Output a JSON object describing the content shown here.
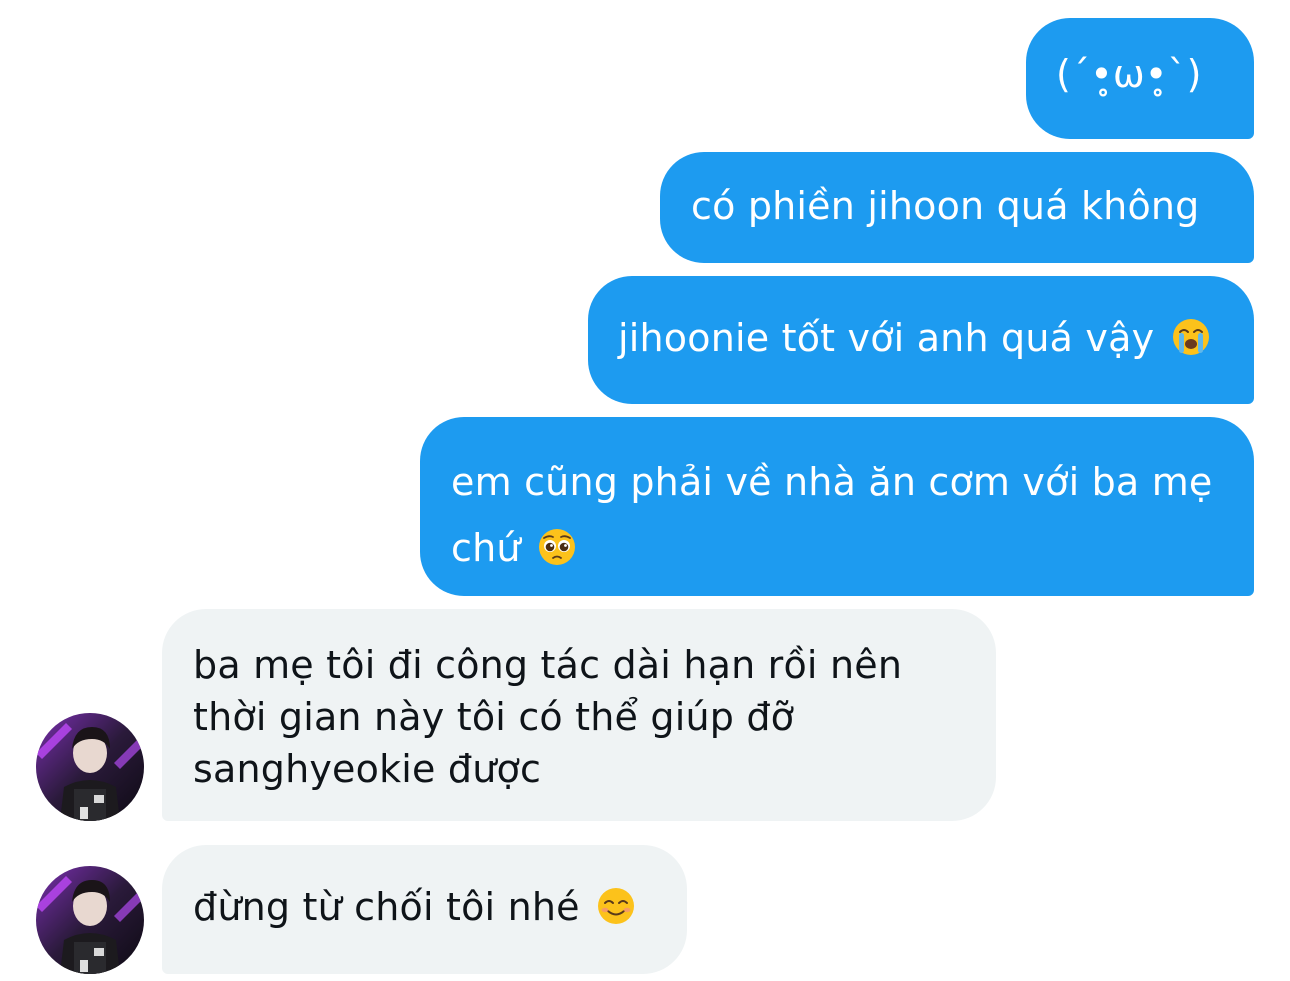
{
  "messages": {
    "m1": {
      "text": "(´•̥ω•̥`)"
    },
    "m2": {
      "text": "có phiền jihoon quá không"
    },
    "m3": {
      "text": "jihoonie tốt với anh quá vậy",
      "emoji": "loudly-crying-face-icon"
    },
    "m4": {
      "line1": "em cũng phải về nhà ăn cơm với ba mẹ",
      "line2": "chứ",
      "emoji": "pleading-face-icon"
    },
    "m5": {
      "line1": "ba mẹ tôi đi công tác dài hạn rồi nên",
      "line2": "thời gian này tôi có thể giúp đỡ",
      "line3": "sanghyeokie được"
    },
    "m6": {
      "text": "đừng từ chối tôi nhé",
      "emoji": "smiling-face-icon"
    }
  },
  "colors": {
    "outgoing_bubble": "#1d9bf0",
    "incoming_bubble": "#eff3f4",
    "outgoing_text": "#ffffff",
    "incoming_text": "#0f1419"
  }
}
